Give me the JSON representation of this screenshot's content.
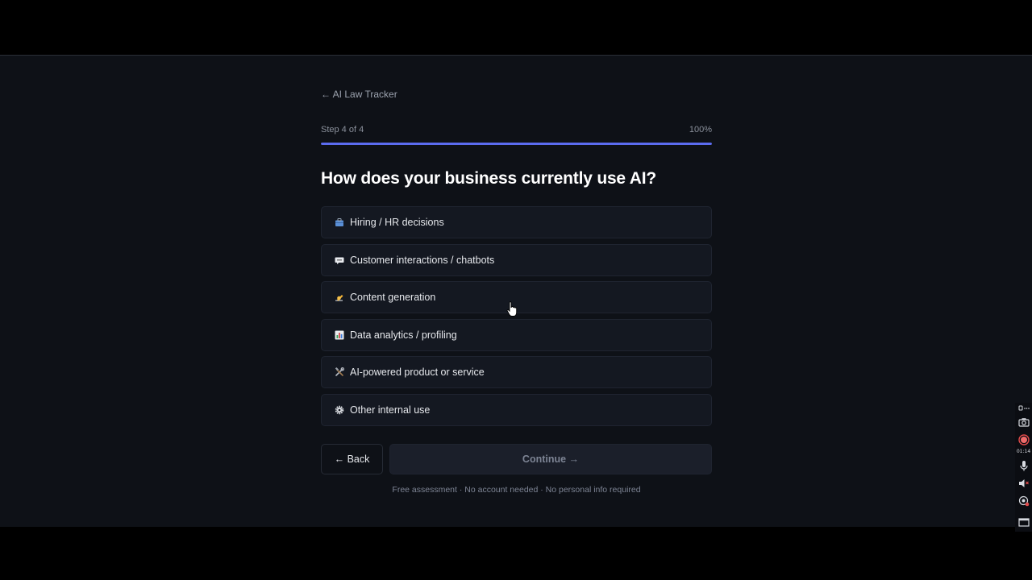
{
  "nav": {
    "back_link": "← AI Law Tracker"
  },
  "progress": {
    "step_text": "Step 4 of 4",
    "percent_text": "100%",
    "fraction": 1.0,
    "accent_color": "#5b6cf0"
  },
  "question": {
    "title": "How does your business currently use AI?"
  },
  "options": [
    {
      "icon": "briefcase-icon",
      "label": "Hiring / HR decisions"
    },
    {
      "icon": "speech-bubble-icon",
      "label": "Customer interactions / chatbots"
    },
    {
      "icon": "writing-hand-icon",
      "label": "Content generation"
    },
    {
      "icon": "bar-chart-icon",
      "label": "Data analytics / profiling"
    },
    {
      "icon": "hammer-wrench-icon",
      "label": "AI-powered product or service"
    },
    {
      "icon": "gear-icon",
      "label": "Other internal use"
    }
  ],
  "actions": {
    "back_label": "← Back",
    "continue_label": "Continue →"
  },
  "footer": {
    "note": "Free assessment · No account needed · No personal info required"
  },
  "recorder_toolbar": {
    "timer": "01:14",
    "icons": [
      "pin-icon",
      "more-icon",
      "camera-icon",
      "record-icon",
      "microphone-icon",
      "speaker-muted-icon",
      "webcam-off-icon",
      "window-icon"
    ]
  }
}
